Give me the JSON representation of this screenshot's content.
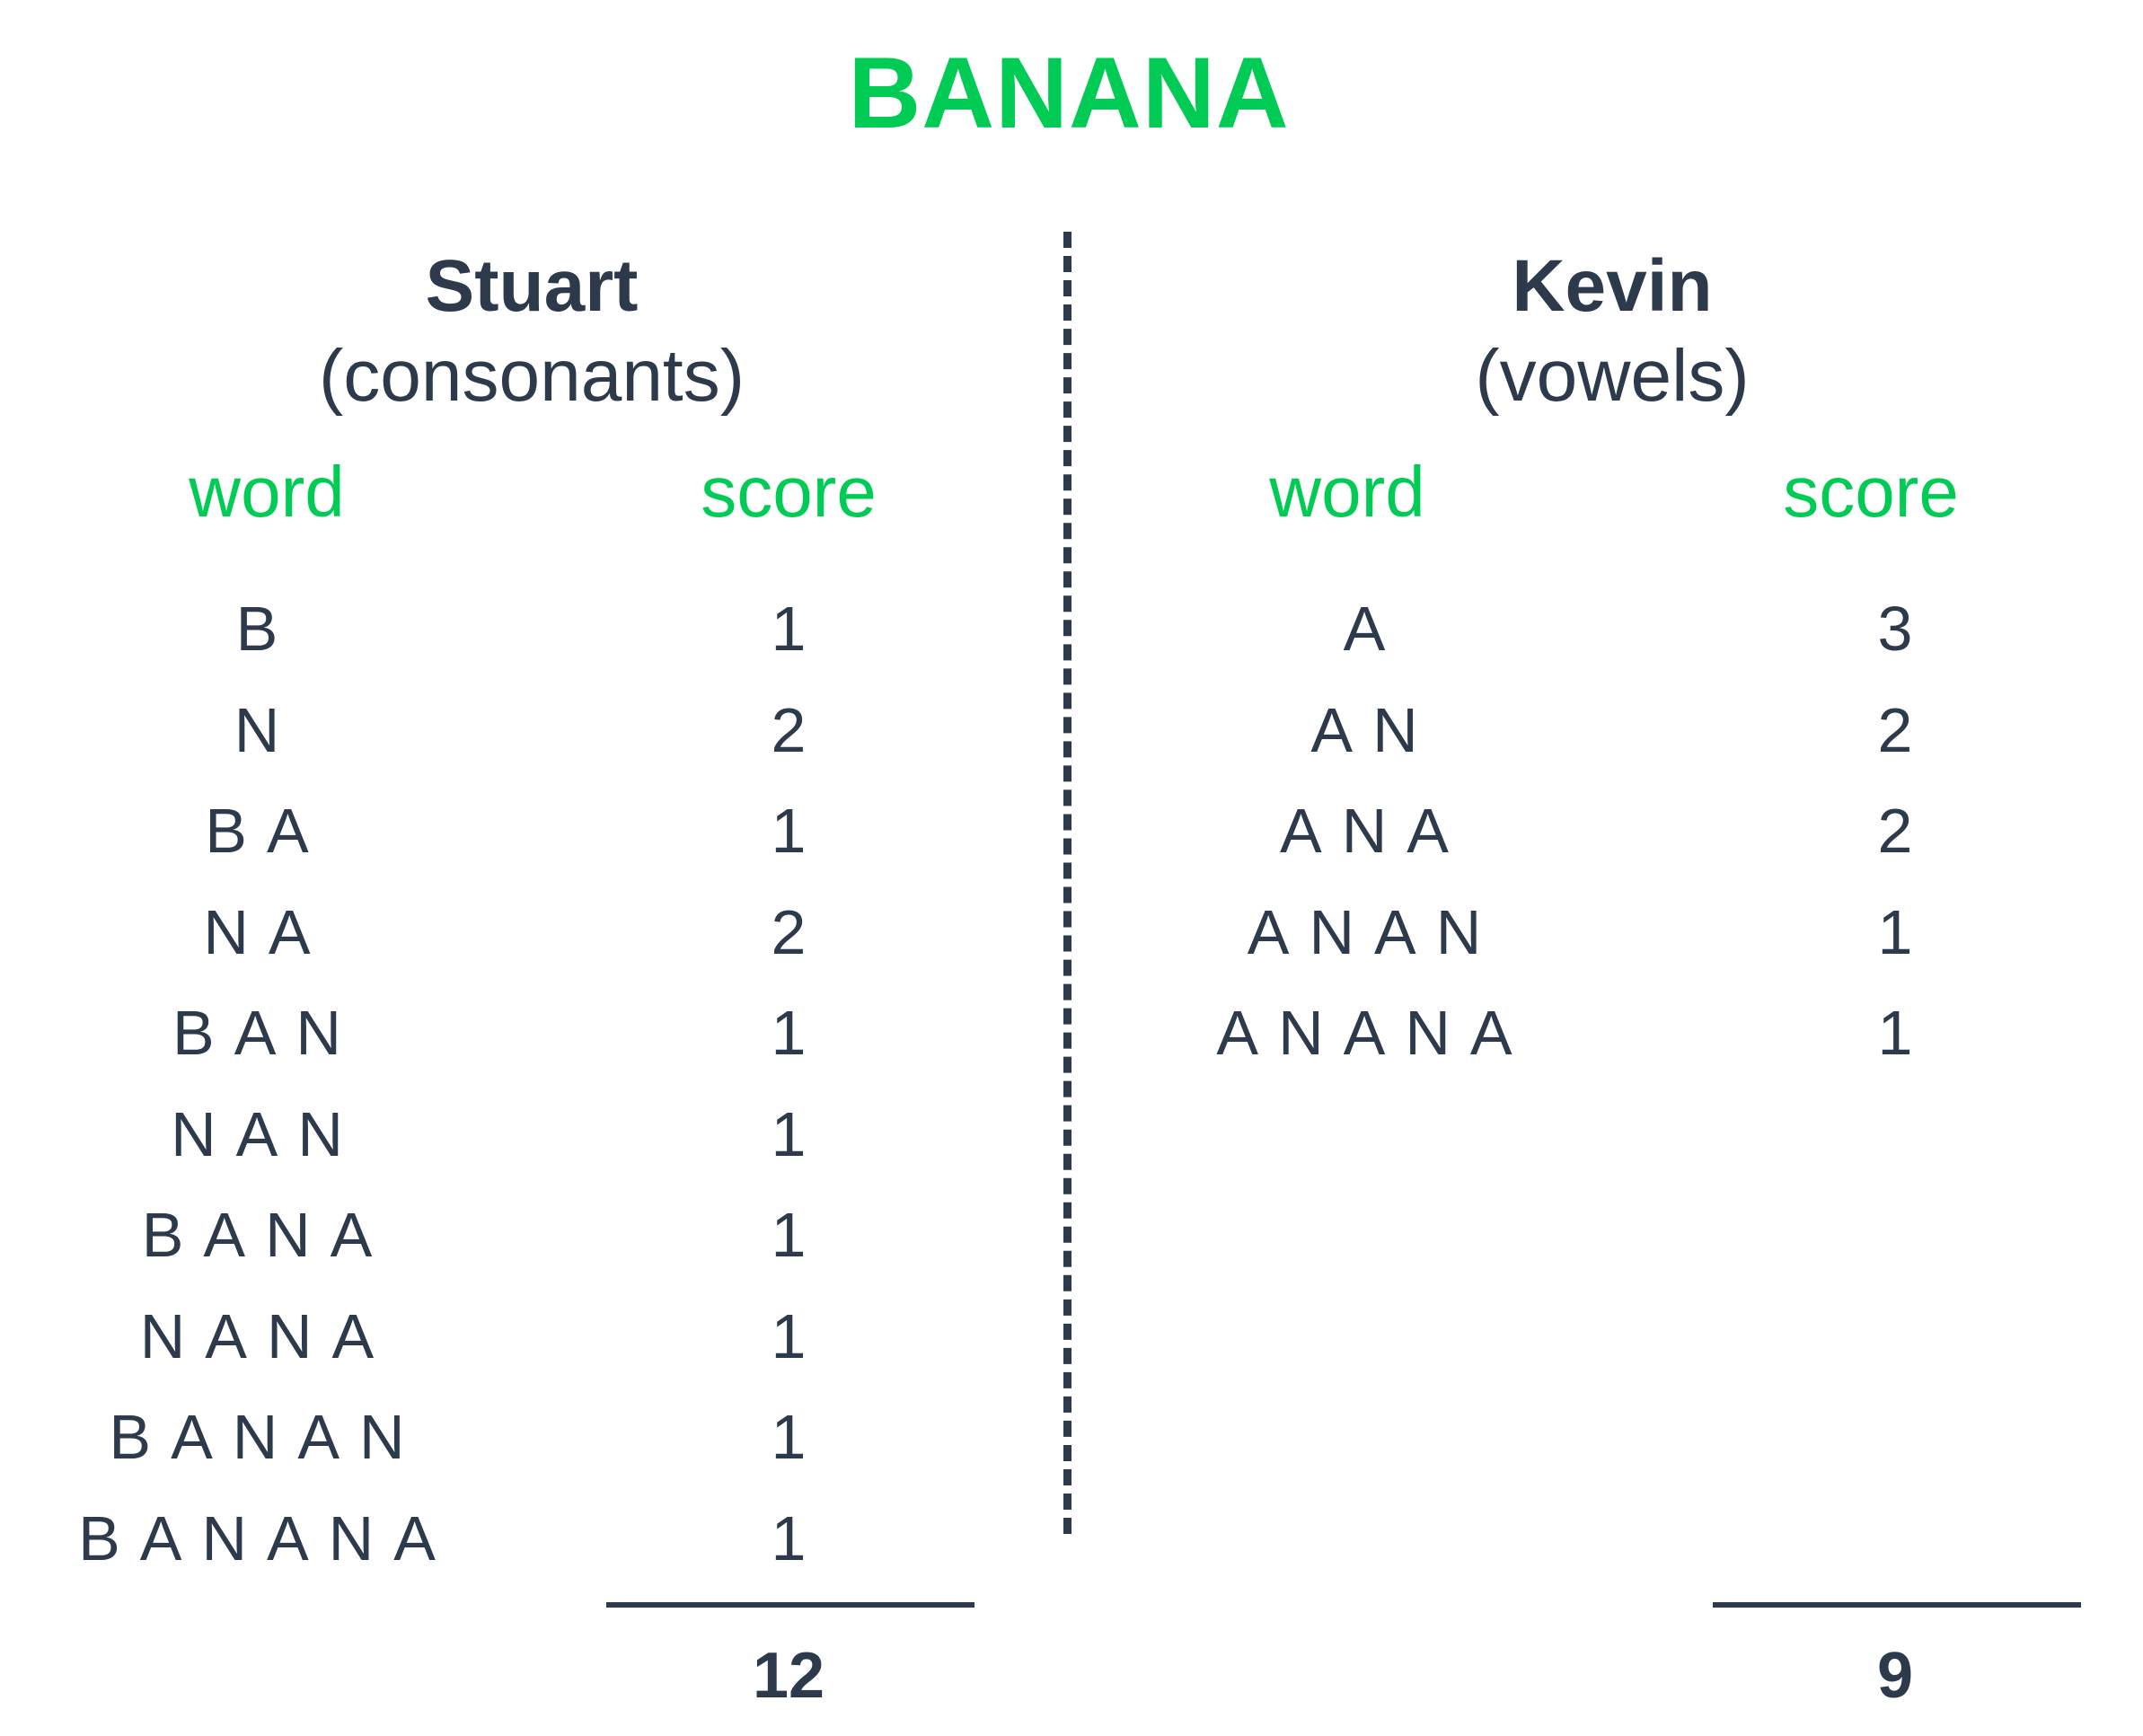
{
  "title": "BANANA",
  "players": [
    {
      "name": "Stuart",
      "subtitle": "(consonants)",
      "word_header": "word",
      "score_header": "score",
      "rows": [
        {
          "word": "B",
          "score": "1"
        },
        {
          "word": "N",
          "score": "2"
        },
        {
          "word": "BA",
          "score": "1"
        },
        {
          "word": "NA",
          "score": "2"
        },
        {
          "word": "BAN",
          "score": "1"
        },
        {
          "word": "NAN",
          "score": "1"
        },
        {
          "word": "BANA",
          "score": "1"
        },
        {
          "word": "NANA",
          "score": "1"
        },
        {
          "word": "BANAN",
          "score": "1"
        },
        {
          "word": "BANANA",
          "score": "1"
        }
      ],
      "total": "12"
    },
    {
      "name": "Kevin",
      "subtitle": "(vowels)",
      "word_header": "word",
      "score_header": "score",
      "rows": [
        {
          "word": "A",
          "score": "3"
        },
        {
          "word": "AN",
          "score": "2"
        },
        {
          "word": "ANA",
          "score": "2"
        },
        {
          "word": "ANAN",
          "score": "1"
        },
        {
          "word": "ANANA",
          "score": "1"
        }
      ],
      "total": "9"
    }
  ],
  "colors": {
    "accent": "#00cc55",
    "text": "#2d3a4b"
  }
}
